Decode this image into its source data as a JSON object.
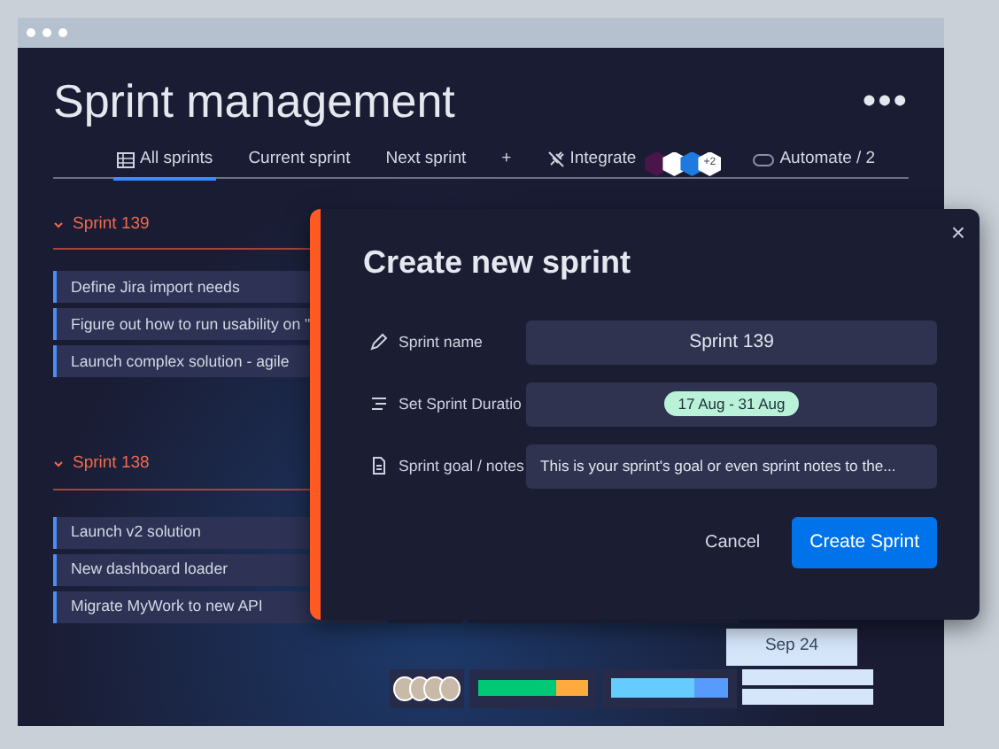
{
  "board": {
    "title": "Sprint management",
    "more_menu": "•••",
    "tabs": [
      {
        "label": "All sprints",
        "selected": true
      },
      {
        "label": "Current sprint",
        "selected": false
      },
      {
        "label": "Next sprint",
        "selected": false
      }
    ],
    "add_tab": "+",
    "integrate": {
      "label": "Integrate",
      "more": "+2"
    },
    "automate": {
      "label": "Automate / 2"
    },
    "groups": [
      {
        "name": "Sprint 139",
        "expanded": true,
        "tasks": [
          "Define Jira import needs",
          "Figure out how to run usability on \"",
          "Launch complex solution - agile"
        ]
      },
      {
        "name": "Sprint 138",
        "expanded": true,
        "tasks": [
          "Launch v2 solution",
          "New dashboard loader",
          "Migrate MyWork to new API"
        ]
      }
    ],
    "date_chip": "Sep 24"
  },
  "modal": {
    "close": "×",
    "title": "Create new sprint",
    "fields": [
      {
        "kind": "text",
        "label": "Sprint name",
        "value": "Sprint 139"
      },
      {
        "kind": "pill",
        "label": "Set Sprint Duratio",
        "value": "17 Aug - 31 Aug"
      },
      {
        "kind": "notes",
        "label": "Sprint goal / notes",
        "value": "This is your sprint's goal or even sprint notes to the..."
      }
    ],
    "cancel": "Cancel",
    "submit": "Create Sprint"
  }
}
